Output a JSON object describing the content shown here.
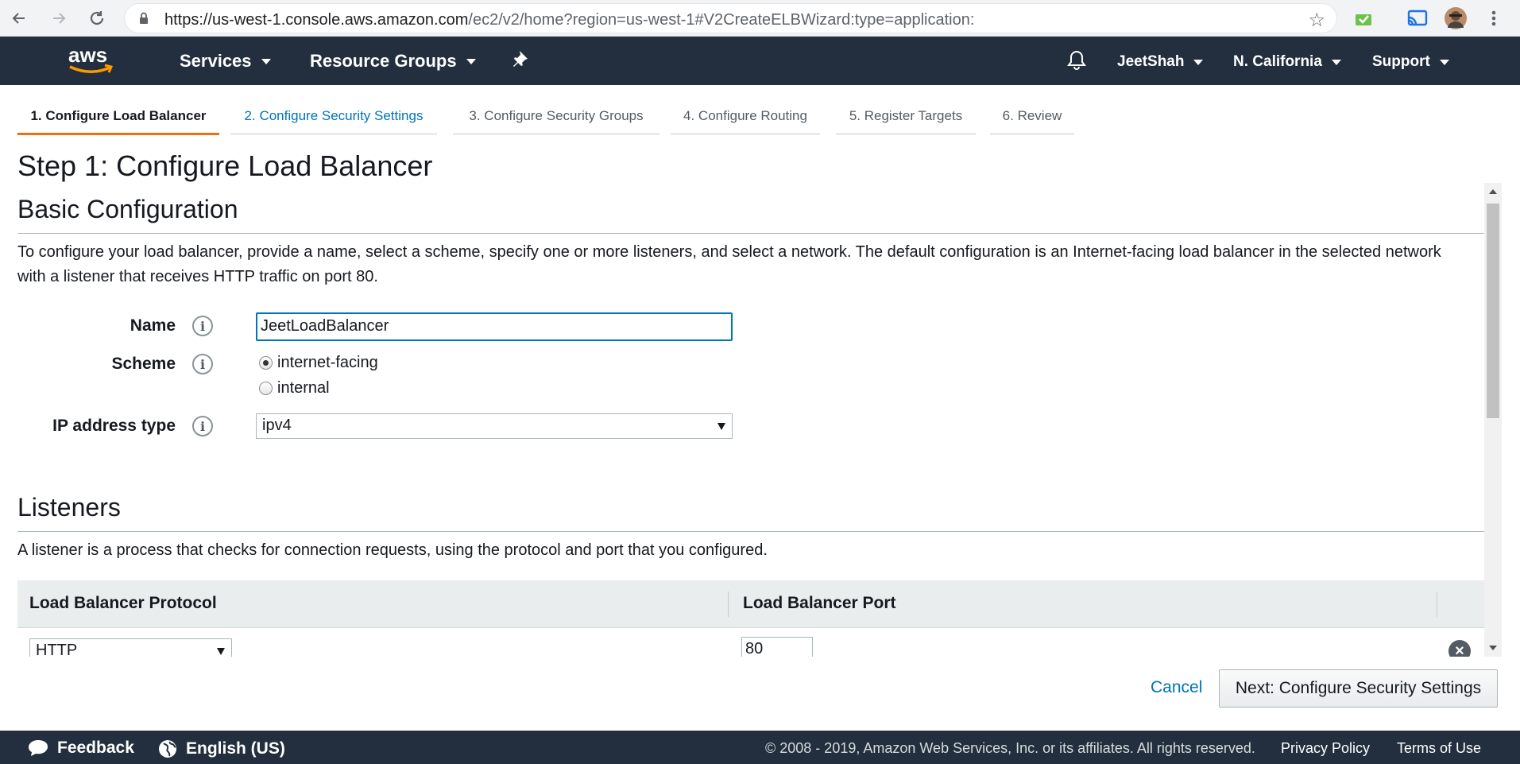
{
  "browser": {
    "url_host": "https://us-west-1.console.aws.amazon.com",
    "url_path": "/ec2/v2/home?region=us-west-1#V2CreateELBWizard:type=application:"
  },
  "awsnav": {
    "logo_text": "aws",
    "services": "Services",
    "resource_groups": "Resource Groups",
    "user": "JeetShah",
    "region": "N. California",
    "support": "Support"
  },
  "tabs": [
    {
      "label": "1. Configure Load Balancer"
    },
    {
      "label": "2. Configure Security Settings"
    },
    {
      "label": "3. Configure Security Groups"
    },
    {
      "label": "4. Configure Routing"
    },
    {
      "label": "5. Register Targets"
    },
    {
      "label": "6. Review"
    }
  ],
  "page": {
    "title": "Step 1: Configure Load Balancer"
  },
  "basic": {
    "heading": "Basic Configuration",
    "description": "To configure your load balancer, provide a name, select a scheme, specify one or more listeners, and select a network. The default configuration is an Internet-facing load balancer in the selected network with a listener that receives HTTP traffic on port 80.",
    "name_label": "Name",
    "name_value": "JeetLoadBalancer",
    "scheme_label": "Scheme",
    "scheme_options": [
      "internet-facing",
      "internal"
    ],
    "scheme_selected": "internet-facing",
    "ip_label": "IP address type",
    "ip_value": "ipv4",
    "info_glyph": "i"
  },
  "listeners": {
    "heading": "Listeners",
    "description": "A listener is a process that checks for connection requests, using the protocol and port that you configured.",
    "col_protocol": "Load Balancer Protocol",
    "col_port": "Load Balancer Port",
    "rows": [
      {
        "protocol": "HTTP",
        "port": "80"
      }
    ]
  },
  "actions": {
    "cancel": "Cancel",
    "next": "Next: Configure Security Settings"
  },
  "footer": {
    "feedback": "Feedback",
    "language": "English (US)",
    "copyright": "© 2008 - 2019, Amazon Web Services, Inc. or its affiliates. All rights reserved.",
    "privacy": "Privacy Policy",
    "terms": "Terms of Use"
  },
  "colors": {
    "nav_bg": "#232f3e",
    "accent": "#ec7211",
    "link": "#0073bb"
  }
}
